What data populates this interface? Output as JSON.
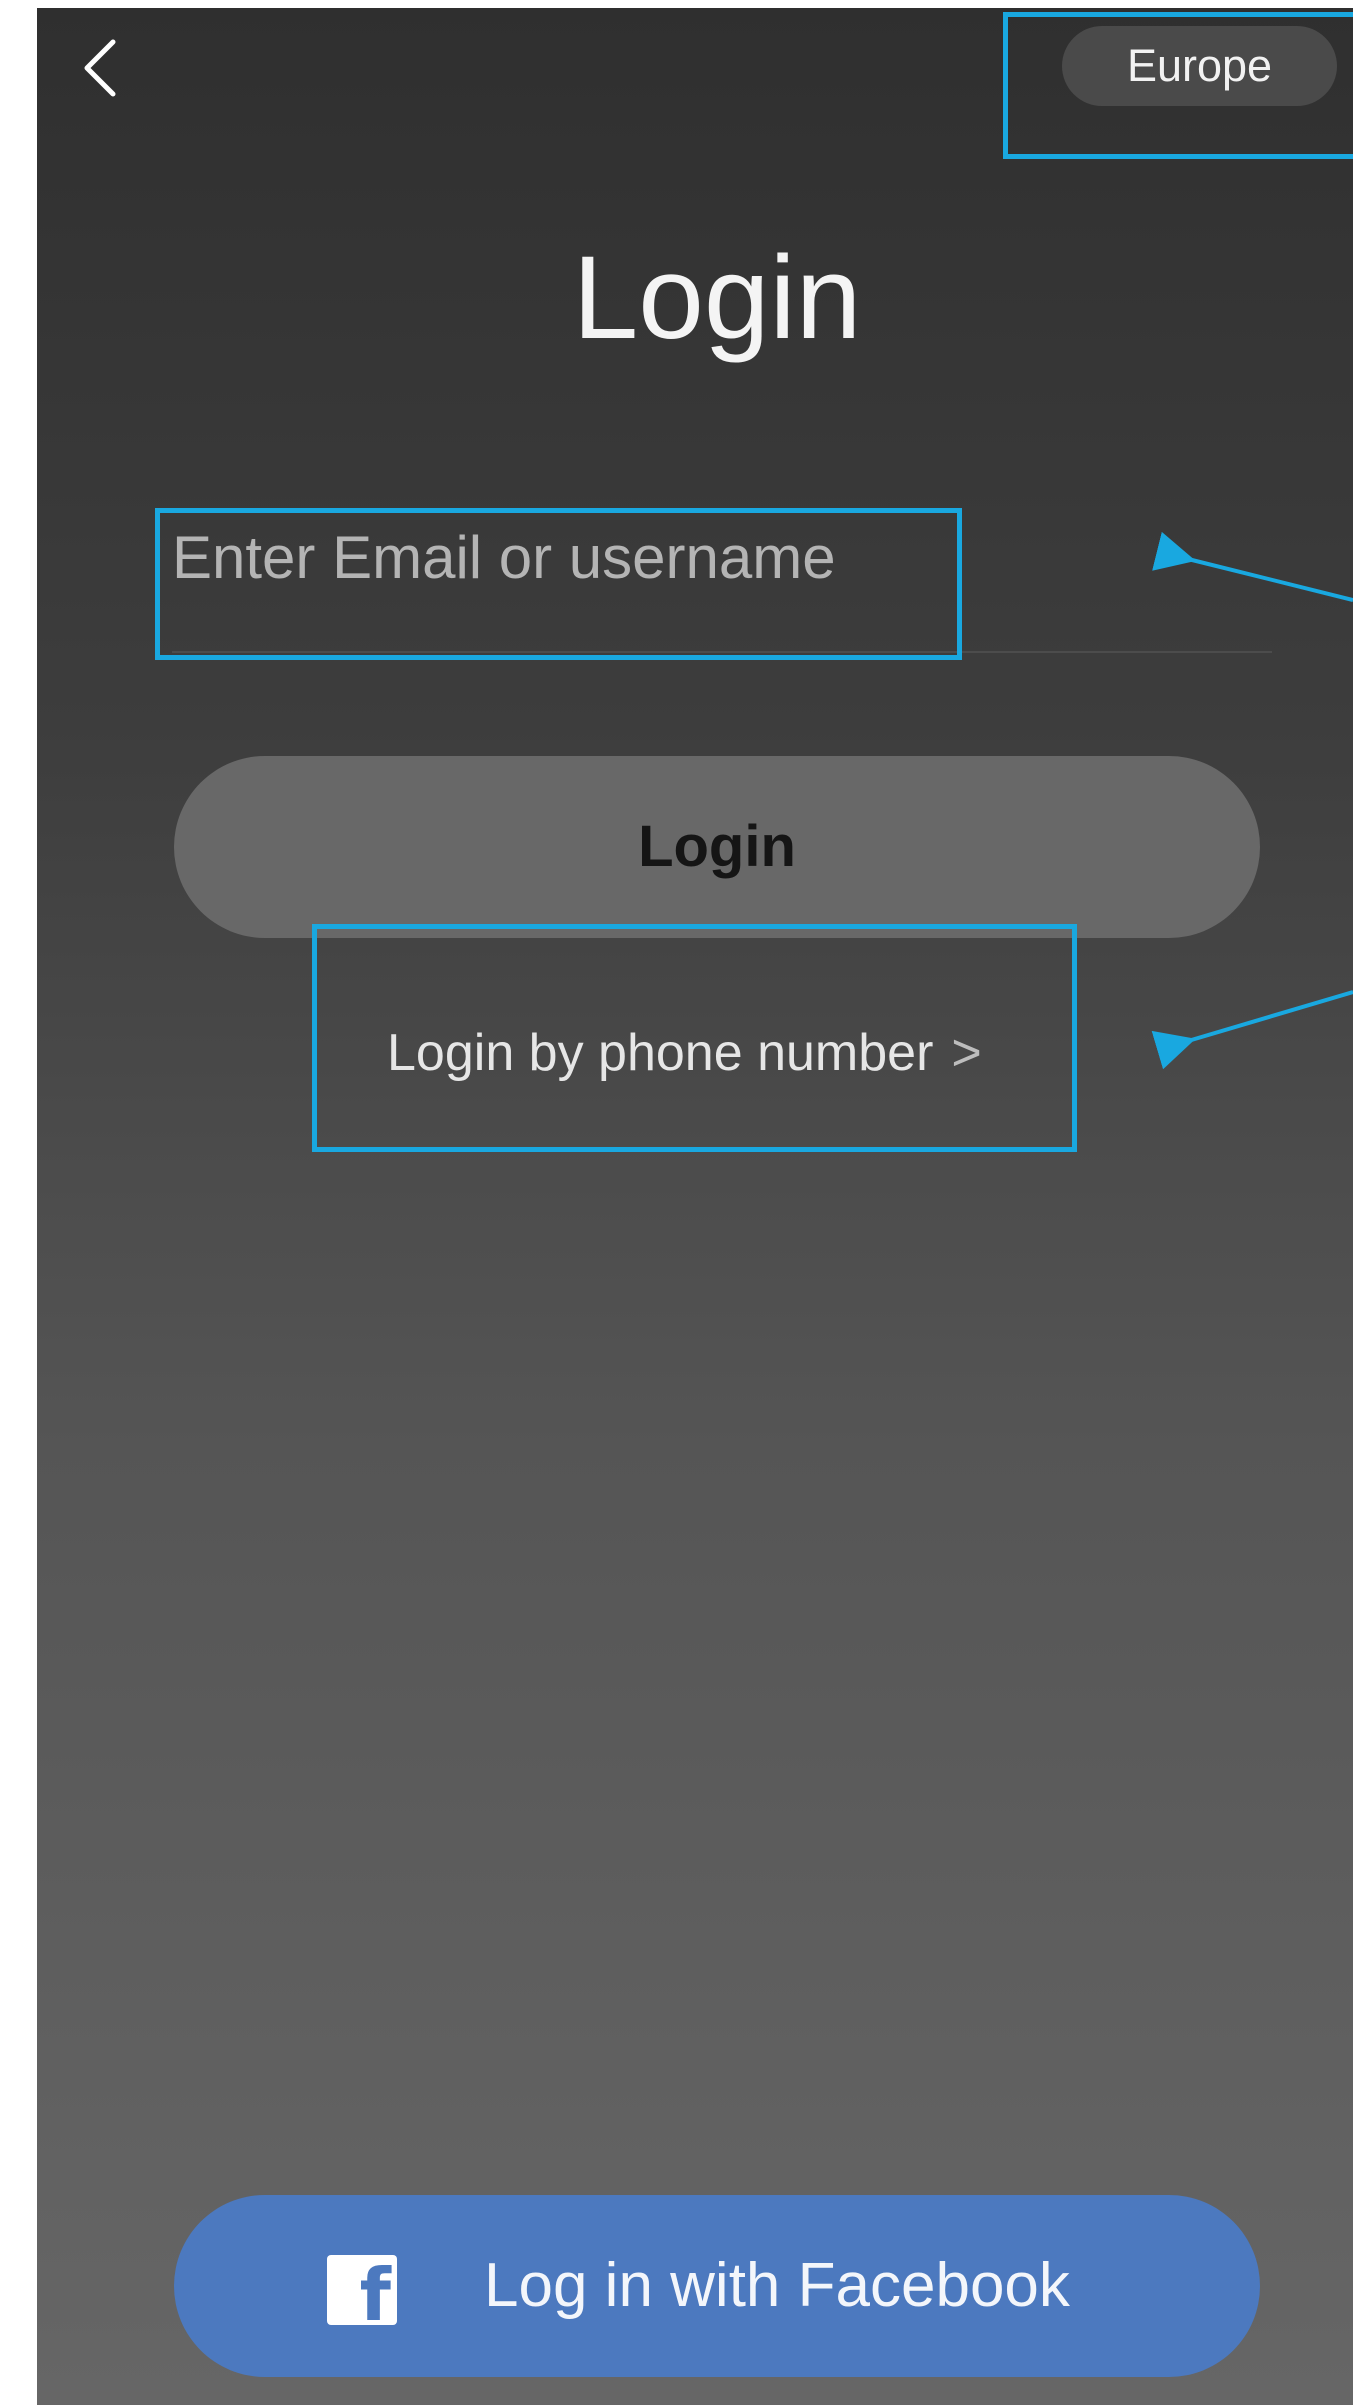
{
  "header": {
    "back_icon": "chevron-left-icon",
    "region_label": "Europe"
  },
  "main": {
    "title": "Login",
    "email_placeholder": "Enter Email or username",
    "login_button_label": "Login",
    "phone_login_label": "Login by phone number",
    "phone_login_chevron": ">"
  },
  "footer": {
    "facebook_icon": "facebook-icon",
    "facebook_icon_glyph": "f",
    "facebook_button_label": "Log in with Facebook"
  },
  "colors": {
    "accent_annotation": "#19a8e0",
    "facebook_blue": "#4c79bf"
  }
}
